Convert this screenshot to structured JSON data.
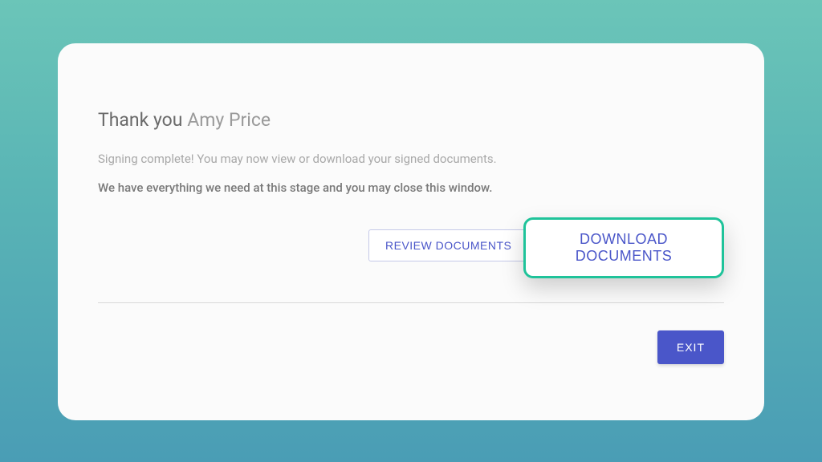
{
  "heading": {
    "prefix": "Thank you ",
    "name": "Amy Price"
  },
  "messages": {
    "line1": "Signing complete! You may now view or download your signed documents.",
    "line2": "We have everything we need at this stage and you may close this window."
  },
  "buttons": {
    "review": "REVIEW DOCUMENTS",
    "download": "DOWNLOAD DOCUMENTS",
    "exit": "EXIT"
  },
  "colors": {
    "accent": "#4a56c9",
    "highlight_border": "#1fc39a"
  }
}
